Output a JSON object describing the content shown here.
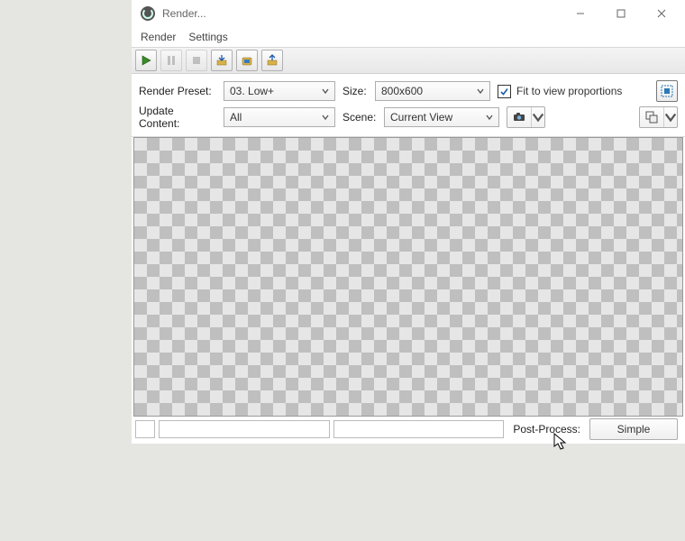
{
  "window": {
    "title": "Render..."
  },
  "menu": {
    "render": "Render",
    "settings": "Settings"
  },
  "labels": {
    "render_preset": "Render Preset:",
    "update_content": "Update Content:",
    "size": "Size:",
    "scene": "Scene:",
    "post_process": "Post-Process:"
  },
  "values": {
    "preset": "03. Low+",
    "update": "All",
    "size": "800x600",
    "scene": "Current View"
  },
  "checkbox": {
    "fit_label": "Fit to view proportions",
    "fit_checked": true
  },
  "buttons": {
    "post_process": "Simple"
  },
  "colors": {
    "accent_blue": "#2a7ab8",
    "check_blue": "#1a5fa8"
  }
}
